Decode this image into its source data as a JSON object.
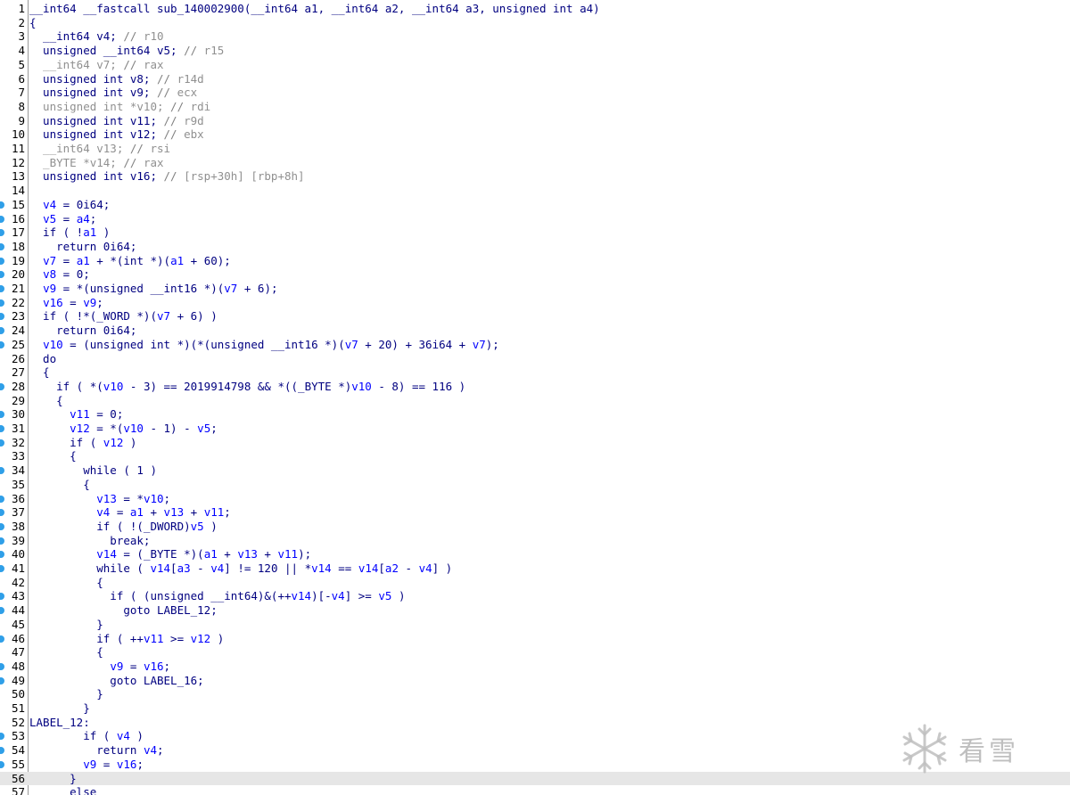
{
  "editor": {
    "colors": {
      "keyword": "#000080",
      "variable": "#0000ff",
      "comment": "#808080",
      "highlight": "#e6e6e6",
      "breakpoint": "#2f9fe8"
    },
    "current_line": 56,
    "lines": [
      {
        "n": "1",
        "bp": false,
        "t": [
          [
            "t",
            "__int64 __fastcall sub_140002900(__int64 a1, __int64 a2, __int64 a3, unsigned int a4)"
          ]
        ]
      },
      {
        "n": "2",
        "bp": false,
        "t": [
          [
            "t",
            "{"
          ]
        ]
      },
      {
        "n": "3",
        "bp": false,
        "t": [
          [
            "t",
            "  __int64 v4; "
          ],
          [
            "c",
            "// "
          ],
          [
            "g",
            "r10"
          ]
        ]
      },
      {
        "n": "4",
        "bp": false,
        "t": [
          [
            "t",
            "  unsigned __int64 v5; "
          ],
          [
            "c",
            "// "
          ],
          [
            "g",
            "r15"
          ]
        ]
      },
      {
        "n": "5",
        "bp": false,
        "t": [
          [
            "g",
            "  __int64 v7; "
          ],
          [
            "c",
            "// "
          ],
          [
            "g",
            "rax"
          ]
        ]
      },
      {
        "n": "6",
        "bp": false,
        "t": [
          [
            "t",
            "  unsigned int v8; "
          ],
          [
            "c",
            "// "
          ],
          [
            "g",
            "r14d"
          ]
        ]
      },
      {
        "n": "7",
        "bp": false,
        "t": [
          [
            "t",
            "  unsigned int v9; "
          ],
          [
            "c",
            "// "
          ],
          [
            "g",
            "ecx"
          ]
        ]
      },
      {
        "n": "8",
        "bp": false,
        "t": [
          [
            "g",
            "  unsigned int *v10; "
          ],
          [
            "c",
            "// "
          ],
          [
            "g",
            "rdi"
          ]
        ]
      },
      {
        "n": "9",
        "bp": false,
        "t": [
          [
            "t",
            "  unsigned int v11; "
          ],
          [
            "c",
            "// "
          ],
          [
            "g",
            "r9d"
          ]
        ]
      },
      {
        "n": "10",
        "bp": false,
        "t": [
          [
            "t",
            "  unsigned int v12; "
          ],
          [
            "c",
            "// "
          ],
          [
            "g",
            "ebx"
          ]
        ]
      },
      {
        "n": "11",
        "bp": false,
        "t": [
          [
            "g",
            "  __int64 v13; "
          ],
          [
            "c",
            "// "
          ],
          [
            "g",
            "rsi"
          ]
        ]
      },
      {
        "n": "12",
        "bp": false,
        "t": [
          [
            "g",
            "  _BYTE *v14; "
          ],
          [
            "c",
            "// "
          ],
          [
            "g",
            "rax"
          ]
        ]
      },
      {
        "n": "13",
        "bp": false,
        "t": [
          [
            "t",
            "  unsigned int v16; "
          ],
          [
            "c",
            "// "
          ],
          [
            "g",
            "[rsp+30h] [rbp+8h]"
          ]
        ]
      },
      {
        "n": "14",
        "bp": false,
        "t": [
          [
            "t",
            ""
          ]
        ]
      },
      {
        "n": "15",
        "bp": true,
        "t": [
          [
            "t",
            "  "
          ],
          [
            "v",
            "v4"
          ],
          [
            "t",
            " = 0i64;"
          ]
        ]
      },
      {
        "n": "16",
        "bp": true,
        "t": [
          [
            "t",
            "  "
          ],
          [
            "v",
            "v5"
          ],
          [
            "t",
            " = "
          ],
          [
            "v",
            "a4"
          ],
          [
            "t",
            ";"
          ]
        ]
      },
      {
        "n": "17",
        "bp": true,
        "t": [
          [
            "t",
            "  if ( !"
          ],
          [
            "v",
            "a1"
          ],
          [
            "t",
            " )"
          ]
        ]
      },
      {
        "n": "18",
        "bp": true,
        "t": [
          [
            "t",
            "    return 0i64;"
          ]
        ]
      },
      {
        "n": "19",
        "bp": true,
        "t": [
          [
            "t",
            "  "
          ],
          [
            "v",
            "v7"
          ],
          [
            "t",
            " = "
          ],
          [
            "v",
            "a1"
          ],
          [
            "t",
            " + *(int *)("
          ],
          [
            "v",
            "a1"
          ],
          [
            "t",
            " + 60);"
          ]
        ]
      },
      {
        "n": "20",
        "bp": true,
        "t": [
          [
            "t",
            "  "
          ],
          [
            "v",
            "v8"
          ],
          [
            "t",
            " = 0;"
          ]
        ]
      },
      {
        "n": "21",
        "bp": true,
        "t": [
          [
            "t",
            "  "
          ],
          [
            "v",
            "v9"
          ],
          [
            "t",
            " = *(unsigned __int16 *)("
          ],
          [
            "v",
            "v7"
          ],
          [
            "t",
            " + 6);"
          ]
        ]
      },
      {
        "n": "22",
        "bp": true,
        "t": [
          [
            "t",
            "  "
          ],
          [
            "v",
            "v16"
          ],
          [
            "t",
            " = "
          ],
          [
            "v",
            "v9"
          ],
          [
            "t",
            ";"
          ]
        ]
      },
      {
        "n": "23",
        "bp": true,
        "t": [
          [
            "t",
            "  if ( !*(_WORD *)("
          ],
          [
            "v",
            "v7"
          ],
          [
            "t",
            " + 6) )"
          ]
        ]
      },
      {
        "n": "24",
        "bp": true,
        "t": [
          [
            "t",
            "    return 0i64;"
          ]
        ]
      },
      {
        "n": "25",
        "bp": true,
        "t": [
          [
            "t",
            "  "
          ],
          [
            "v",
            "v10"
          ],
          [
            "t",
            " = (unsigned int *)(*(unsigned __int16 *)("
          ],
          [
            "v",
            "v7"
          ],
          [
            "t",
            " + 20) + 36i64 + "
          ],
          [
            "v",
            "v7"
          ],
          [
            "t",
            ");"
          ]
        ]
      },
      {
        "n": "26",
        "bp": false,
        "t": [
          [
            "t",
            "  do"
          ]
        ]
      },
      {
        "n": "27",
        "bp": false,
        "t": [
          [
            "t",
            "  {"
          ]
        ]
      },
      {
        "n": "28",
        "bp": true,
        "t": [
          [
            "t",
            "    if ( *("
          ],
          [
            "v",
            "v10"
          ],
          [
            "t",
            " - 3) == 2019914798 && *((_BYTE *)"
          ],
          [
            "v",
            "v10"
          ],
          [
            "t",
            " - 8) == 116 )"
          ]
        ]
      },
      {
        "n": "29",
        "bp": false,
        "t": [
          [
            "t",
            "    {"
          ]
        ]
      },
      {
        "n": "30",
        "bp": true,
        "t": [
          [
            "t",
            "      "
          ],
          [
            "v",
            "v11"
          ],
          [
            "t",
            " = 0;"
          ]
        ]
      },
      {
        "n": "31",
        "bp": true,
        "t": [
          [
            "t",
            "      "
          ],
          [
            "v",
            "v12"
          ],
          [
            "t",
            " = *("
          ],
          [
            "v",
            "v10"
          ],
          [
            "t",
            " - 1) - "
          ],
          [
            "v",
            "v5"
          ],
          [
            "t",
            ";"
          ]
        ]
      },
      {
        "n": "32",
        "bp": true,
        "t": [
          [
            "t",
            "      if ( "
          ],
          [
            "v",
            "v12"
          ],
          [
            "t",
            " )"
          ]
        ]
      },
      {
        "n": "33",
        "bp": false,
        "t": [
          [
            "t",
            "      {"
          ]
        ]
      },
      {
        "n": "34",
        "bp": true,
        "t": [
          [
            "t",
            "        while ( 1 )"
          ]
        ]
      },
      {
        "n": "35",
        "bp": false,
        "t": [
          [
            "t",
            "        {"
          ]
        ]
      },
      {
        "n": "36",
        "bp": true,
        "t": [
          [
            "t",
            "          "
          ],
          [
            "v",
            "v13"
          ],
          [
            "t",
            " = *"
          ],
          [
            "v",
            "v10"
          ],
          [
            "t",
            ";"
          ]
        ]
      },
      {
        "n": "37",
        "bp": true,
        "t": [
          [
            "t",
            "          "
          ],
          [
            "v",
            "v4"
          ],
          [
            "t",
            " = "
          ],
          [
            "v",
            "a1"
          ],
          [
            "t",
            " + "
          ],
          [
            "v",
            "v13"
          ],
          [
            "t",
            " + "
          ],
          [
            "v",
            "v11"
          ],
          [
            "t",
            ";"
          ]
        ]
      },
      {
        "n": "38",
        "bp": true,
        "t": [
          [
            "t",
            "          if ( !(_DWORD)"
          ],
          [
            "v",
            "v5"
          ],
          [
            "t",
            " )"
          ]
        ]
      },
      {
        "n": "39",
        "bp": true,
        "t": [
          [
            "t",
            "            break;"
          ]
        ]
      },
      {
        "n": "40",
        "bp": true,
        "t": [
          [
            "t",
            "          "
          ],
          [
            "v",
            "v14"
          ],
          [
            "t",
            " = (_BYTE *)("
          ],
          [
            "v",
            "a1"
          ],
          [
            "t",
            " + "
          ],
          [
            "v",
            "v13"
          ],
          [
            "t",
            " + "
          ],
          [
            "v",
            "v11"
          ],
          [
            "t",
            ");"
          ]
        ]
      },
      {
        "n": "41",
        "bp": true,
        "t": [
          [
            "t",
            "          while ( "
          ],
          [
            "v",
            "v14"
          ],
          [
            "t",
            "["
          ],
          [
            "v",
            "a3"
          ],
          [
            "t",
            " - "
          ],
          [
            "v",
            "v4"
          ],
          [
            "t",
            "] != 120 || *"
          ],
          [
            "v",
            "v14"
          ],
          [
            "t",
            " == "
          ],
          [
            "v",
            "v14"
          ],
          [
            "t",
            "["
          ],
          [
            "v",
            "a2"
          ],
          [
            "t",
            " - "
          ],
          [
            "v",
            "v4"
          ],
          [
            "t",
            "] )"
          ]
        ]
      },
      {
        "n": "42",
        "bp": false,
        "t": [
          [
            "t",
            "          {"
          ]
        ]
      },
      {
        "n": "43",
        "bp": true,
        "t": [
          [
            "t",
            "            if ( (unsigned __int64)&(++"
          ],
          [
            "v",
            "v14"
          ],
          [
            "t",
            ")[-"
          ],
          [
            "v",
            "v4"
          ],
          [
            "t",
            "] >= "
          ],
          [
            "v",
            "v5"
          ],
          [
            "t",
            " )"
          ]
        ]
      },
      {
        "n": "44",
        "bp": true,
        "t": [
          [
            "t",
            "              goto LABEL_12;"
          ]
        ]
      },
      {
        "n": "45",
        "bp": false,
        "t": [
          [
            "t",
            "          }"
          ]
        ]
      },
      {
        "n": "46",
        "bp": true,
        "t": [
          [
            "t",
            "          if ( ++"
          ],
          [
            "v",
            "v11"
          ],
          [
            "t",
            " >= "
          ],
          [
            "v",
            "v12"
          ],
          [
            "t",
            " )"
          ]
        ]
      },
      {
        "n": "47",
        "bp": false,
        "t": [
          [
            "t",
            "          {"
          ]
        ]
      },
      {
        "n": "48",
        "bp": true,
        "t": [
          [
            "t",
            "            "
          ],
          [
            "v",
            "v9"
          ],
          [
            "t",
            " = "
          ],
          [
            "v",
            "v16"
          ],
          [
            "t",
            ";"
          ]
        ]
      },
      {
        "n": "49",
        "bp": true,
        "t": [
          [
            "t",
            "            goto LABEL_16;"
          ]
        ]
      },
      {
        "n": "50",
        "bp": false,
        "t": [
          [
            "t",
            "          }"
          ]
        ]
      },
      {
        "n": "51",
        "bp": false,
        "t": [
          [
            "t",
            "        }"
          ]
        ]
      },
      {
        "n": "52",
        "bp": false,
        "t": [
          [
            "t",
            "LABEL_12:"
          ]
        ]
      },
      {
        "n": "53",
        "bp": true,
        "t": [
          [
            "t",
            "        if ( "
          ],
          [
            "v",
            "v4"
          ],
          [
            "t",
            " )"
          ]
        ]
      },
      {
        "n": "54",
        "bp": true,
        "t": [
          [
            "t",
            "          return "
          ],
          [
            "v",
            "v4"
          ],
          [
            "t",
            ";"
          ]
        ]
      },
      {
        "n": "55",
        "bp": true,
        "t": [
          [
            "t",
            "        "
          ],
          [
            "v",
            "v9"
          ],
          [
            "t",
            " = "
          ],
          [
            "v",
            "v16"
          ],
          [
            "t",
            ";"
          ]
        ]
      },
      {
        "n": "56",
        "bp": false,
        "t": [
          [
            "t",
            "      }"
          ]
        ]
      },
      {
        "n": "57",
        "bp": false,
        "t": [
          [
            "t",
            "      else"
          ]
        ]
      }
    ]
  },
  "watermark": {
    "text": "看雪",
    "icon": "snowflake-logo-icon"
  }
}
